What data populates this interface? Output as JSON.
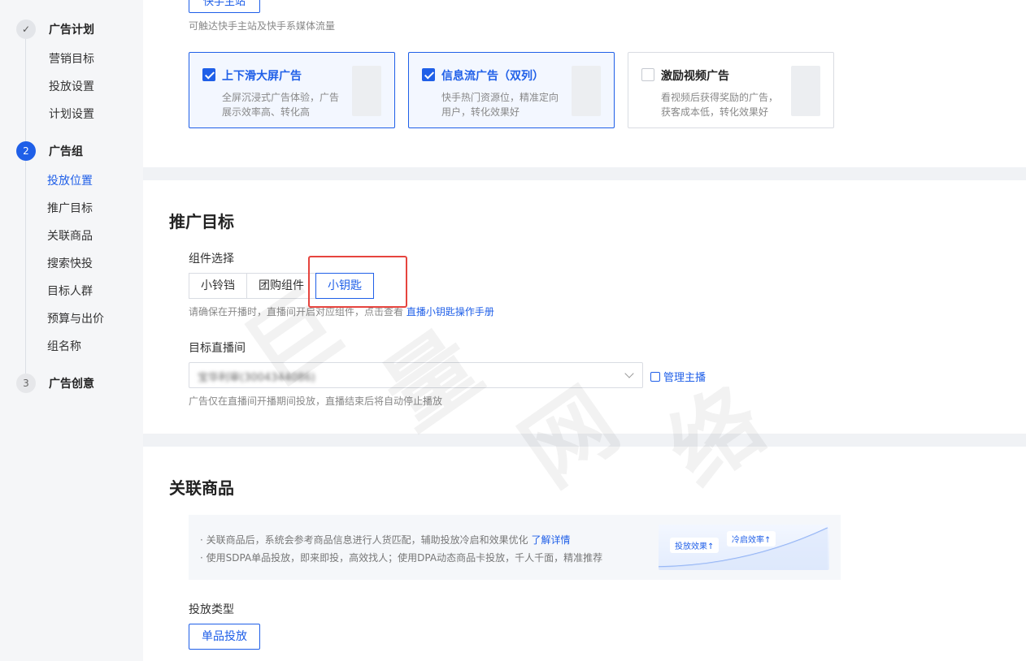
{
  "sidebar": {
    "steps": [
      {
        "number": "✓",
        "label": "广告计划",
        "sub": [
          "营销目标",
          "投放设置",
          "计划设置"
        ]
      },
      {
        "number": "2",
        "label": "广告组",
        "sub": [
          "投放位置",
          "推广目标",
          "关联商品",
          "搜索快投",
          "目标人群",
          "预算与出价",
          "组名称"
        ]
      },
      {
        "number": "3",
        "label": "广告创意",
        "sub": []
      }
    ]
  },
  "placement": {
    "top_button": "快手主站",
    "hint": "可触达快手主站及快手系媒体流量",
    "cards": [
      {
        "title": "上下滑大屏广告",
        "desc": "全屏沉浸式广告体验，广告展示效率高、转化高",
        "checked": true
      },
      {
        "title": "信息流广告（双列）",
        "desc": "快手热门资源位，精准定向用户，转化效果好",
        "checked": true
      },
      {
        "title": "激励视频广告",
        "desc": "看视频后获得奖励的广告，获客成本低，转化效果好",
        "checked": false
      }
    ]
  },
  "promo": {
    "title": "推广目标",
    "component_label": "组件选择",
    "components": [
      "小铃铛",
      "团购组件",
      "小钥匙"
    ],
    "selected_component": "小钥匙",
    "component_hint": "请确保在开播时，直播间开启对应组件，点击查看",
    "component_hint_link": "直播小钥匙操作手册",
    "room_label": "目标直播间",
    "room_value": "宝华利审(3004344086)",
    "manage_link": "管理主播",
    "room_hint": "广告仅在直播间开播期间投放，直播结束后将自动停止播放"
  },
  "product": {
    "title": "关联商品",
    "info_line1": "· 关联商品后，系统会参考商品信息进行人货匹配，辅助投放冷启和效果优化",
    "info_line1_link": "了解详情",
    "info_line2": "· 使用SDPA单品投放，即来即投，高效找人；使用DPA动态商品卡投放，千人千面，精准推荐",
    "tag1": "投放效果↑",
    "tag2": "冷启效率↑",
    "type_label": "投放类型",
    "type_button": "单品投放"
  },
  "watermark": [
    "巨",
    "量",
    "网",
    "络"
  ],
  "colors": {
    "accent": "#1f5fe8",
    "highlight": "#e6443e"
  }
}
